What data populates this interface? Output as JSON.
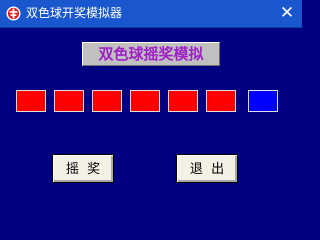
{
  "window": {
    "title": "双色球开奖模拟器",
    "close_glyph": "✕"
  },
  "main": {
    "heading": "双色球摇奖模拟",
    "balls": [
      {
        "color": "red"
      },
      {
        "color": "red"
      },
      {
        "color": "red"
      },
      {
        "color": "red"
      },
      {
        "color": "red"
      },
      {
        "color": "red"
      },
      {
        "color": "blue"
      }
    ],
    "draw_button_label": "摇  奖",
    "exit_button_label": "退  出"
  },
  "colors": {
    "background": "#000080",
    "titlebar": "#1a57cf",
    "heading_text": "#a020c8",
    "red_ball": "#ff0000",
    "blue_ball": "#0000ff"
  },
  "icons": {
    "app": "app-logo-icon",
    "close": "close-icon"
  }
}
